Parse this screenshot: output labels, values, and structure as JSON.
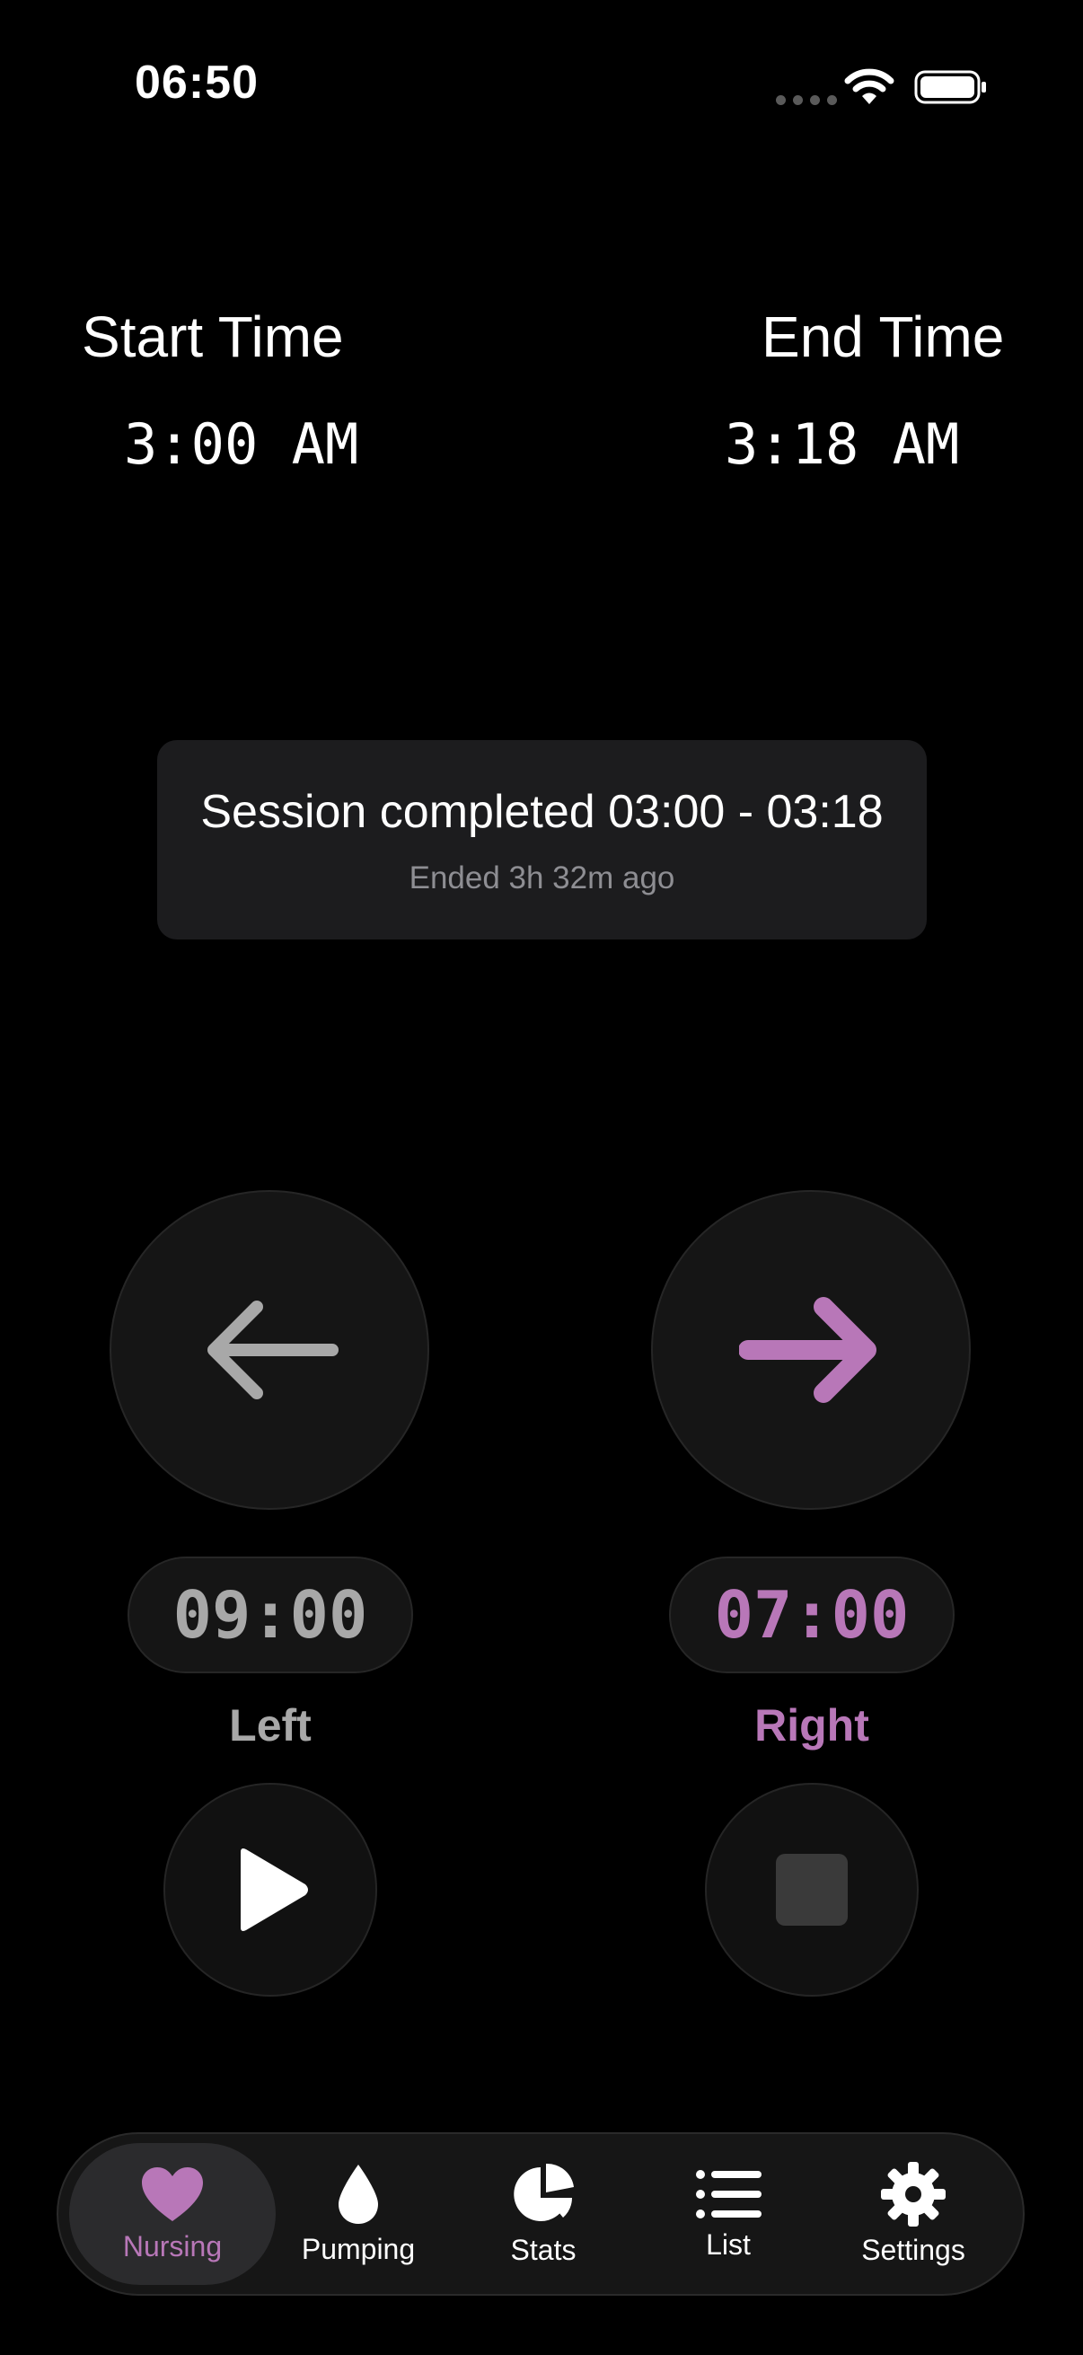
{
  "status_bar": {
    "time": "06:50"
  },
  "times": {
    "start_label": "Start Time",
    "start_value": "3:00 AM",
    "end_label": "End Time",
    "end_value": "3:18 AM"
  },
  "session_card": {
    "title": "Session completed 03:00 - 03:18",
    "subtitle": "Ended 3h 32m ago"
  },
  "left": {
    "timer": "09:00",
    "label": "Left",
    "color": "#a8a8a8",
    "arrow_icon": "arrow-left-icon",
    "control_icon": "play-icon"
  },
  "right": {
    "timer": "07:00",
    "label": "Right",
    "color": "#b877b8",
    "arrow_icon": "arrow-right-icon",
    "control_icon": "stop-icon"
  },
  "tabs": [
    {
      "label": "Nursing",
      "icon": "heart-icon",
      "active": true
    },
    {
      "label": "Pumping",
      "icon": "drop-icon"
    },
    {
      "label": "Stats",
      "icon": "pie-chart-icon"
    },
    {
      "label": "List",
      "icon": "list-icon"
    },
    {
      "label": "Settings",
      "icon": "gear-icon"
    }
  ],
  "colors": {
    "accent": "#b877b8",
    "background": "#000000",
    "card": "#1c1c1e"
  }
}
